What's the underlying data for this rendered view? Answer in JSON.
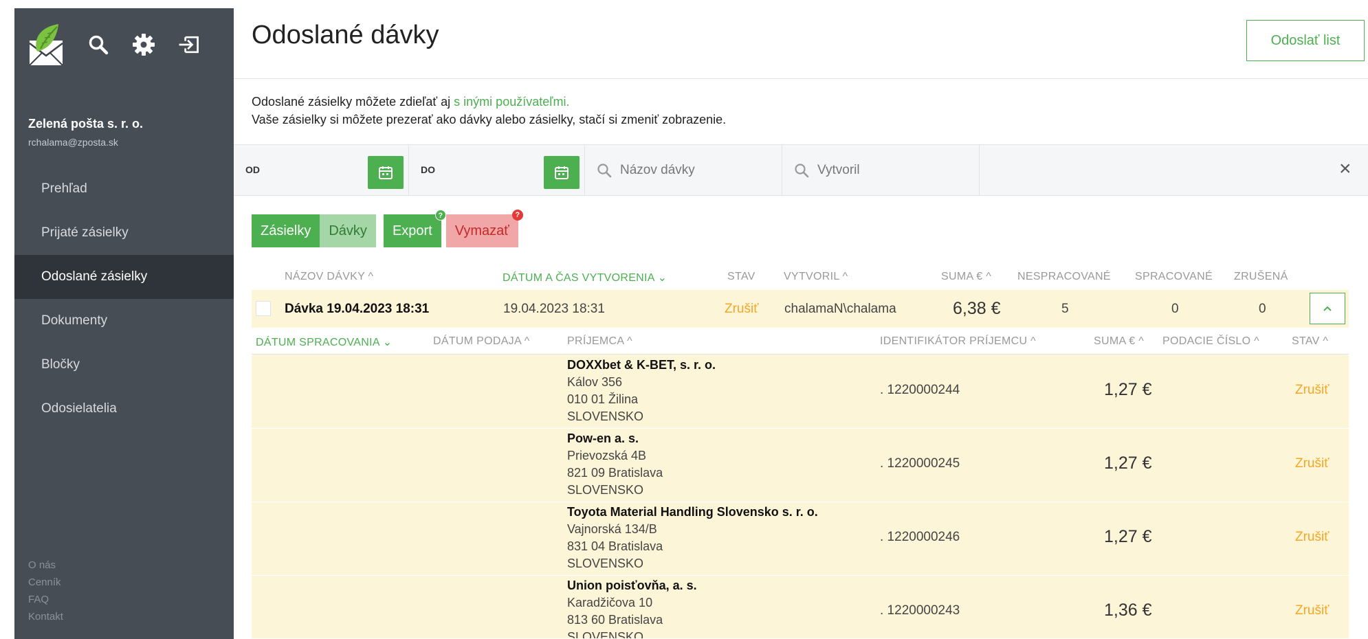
{
  "sidebar": {
    "org_name": "Zelená pošta s. r. o.",
    "org_email": "rchalama@zposta.sk",
    "items": [
      {
        "label": "Prehľad"
      },
      {
        "label": "Prijaté zásielky"
      },
      {
        "label": "Odoslané zásielky"
      },
      {
        "label": "Dokumenty"
      },
      {
        "label": "Bločky"
      },
      {
        "label": "Odosielatelia"
      }
    ],
    "active_index": 2,
    "footer": [
      "O nás",
      "Cenník",
      "FAQ",
      "Kontakt"
    ],
    "icons": [
      "logo-icon",
      "search-icon",
      "gear-icon",
      "logout-icon"
    ]
  },
  "header": {
    "title": "Odoslané dávky",
    "send_button": "Odoslať list"
  },
  "info": {
    "line1_text": "Odoslané zásielky môžete zdieľať aj",
    "line1_link": "s inými používateľmi.",
    "line2": "Vaše zásielky si môžete prezerať ako dávky alebo zásielky, stačí si zmeniť zobrazenie."
  },
  "filters": {
    "from_label": "OD",
    "to_label": "DO",
    "batch_name_placeholder": "Názov dávky",
    "created_by_placeholder": "Vytvoril",
    "clear": "×"
  },
  "actions": {
    "shipments": "Zásielky",
    "batches": "Dávky",
    "export": "Export",
    "export_badge": "?",
    "delete": "Vymazať",
    "delete_badge": "?"
  },
  "batch_table": {
    "headers": {
      "name": "NÁZOV DÁVKY ^",
      "created": "DÁTUM A ČAS VYTVORENIA ⌄",
      "status": "STAV",
      "created_by": "VYTVORIL ^",
      "sum": "SUMA € ^",
      "unprocessed": "NESPRACOVANÉ",
      "processed": "SPRACOVANÉ",
      "cancelled": "ZRUŠENÁ"
    },
    "row": {
      "name": "Dávka 19.04.2023 18:31",
      "created": "19.04.2023 18:31",
      "status": "Zrušiť",
      "created_by": "chalamaN\\chalama",
      "sum": "6,38 €",
      "unprocessed": "5",
      "processed": "0",
      "cancelled": "0"
    }
  },
  "shipment_table": {
    "headers": {
      "processed_date": "DÁTUM SPRACOVANIA ⌄",
      "submitted_date": "DÁTUM PODAJA ^",
      "recipient": "PRÍJEMCA ^",
      "recipient_id": "IDENTIFIKÁTOR PRÍJEMCU ^",
      "sum": "SUMA € ^",
      "tracking": "PODACIE ČÍSLO ^",
      "status": "STAV ^"
    },
    "rows": [
      {
        "name": "DOXXbet & K-BET, s. r. o.",
        "street": "Kálov 356",
        "city": "010 01 Žilina",
        "country": "SLOVENSKO",
        "id": ". 1220000244",
        "sum": "1,27 €",
        "action": "Zrušiť"
      },
      {
        "name": "Pow-en a. s.",
        "street": "Prievozská 4B",
        "city": "821 09 Bratislava",
        "country": "SLOVENSKO",
        "id": ". 1220000245",
        "sum": "1,27 €",
        "action": "Zrušiť"
      },
      {
        "name": "Toyota Material Handling Slovensko s. r. o.",
        "street": "Vajnorská 134/B",
        "city": "831 04 Bratislava",
        "country": "SLOVENSKO",
        "id": ". 1220000246",
        "sum": "1,27 €",
        "action": "Zrušiť"
      },
      {
        "name": "Union poisťovňa, a. s.",
        "street": "Karadžičova 10",
        "city": "813 60 Bratislava",
        "country": "SLOVENSKO",
        "id": ". 1220000243",
        "sum": "1,36 €",
        "action": "Zrušiť"
      }
    ]
  },
  "colors": {
    "accent": "#4caf50",
    "sidebar": "#474d55",
    "sidebar_active": "#2f343a",
    "row_highlight": "#fdf5d7",
    "cancel": "#f5a623",
    "danger": "#f1a7a7"
  }
}
